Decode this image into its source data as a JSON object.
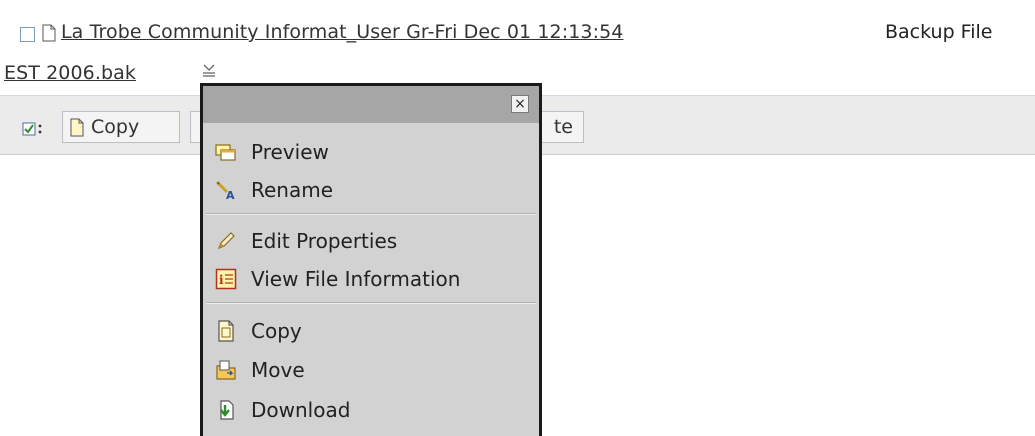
{
  "file_row": {
    "link_line1": "La Trobe Community Informat_User Gr-Fri Dec 01 12:13:54",
    "link_line2": "EST 2006.bak",
    "type_text": "Backup File"
  },
  "toolbar": {
    "copy_label": "Copy",
    "partial_label": "te"
  },
  "popup": {
    "close_glyph": "×",
    "items": [
      {
        "label": "Preview",
        "icon": "preview-icon"
      },
      {
        "label": "Rename",
        "icon": "rename-icon"
      },
      {
        "label": "Edit Properties",
        "icon": "pencil-icon"
      },
      {
        "label": "View File Information",
        "icon": "info-icon"
      },
      {
        "label": "Copy",
        "icon": "copy-icon"
      },
      {
        "label": "Move",
        "icon": "move-icon"
      },
      {
        "label": "Download",
        "icon": "download-icon"
      }
    ]
  },
  "colors": {
    "popup_bg": "#d2d2d2",
    "popup_header": "#a6a6a6",
    "toolbar_bg": "#ebebeb"
  }
}
